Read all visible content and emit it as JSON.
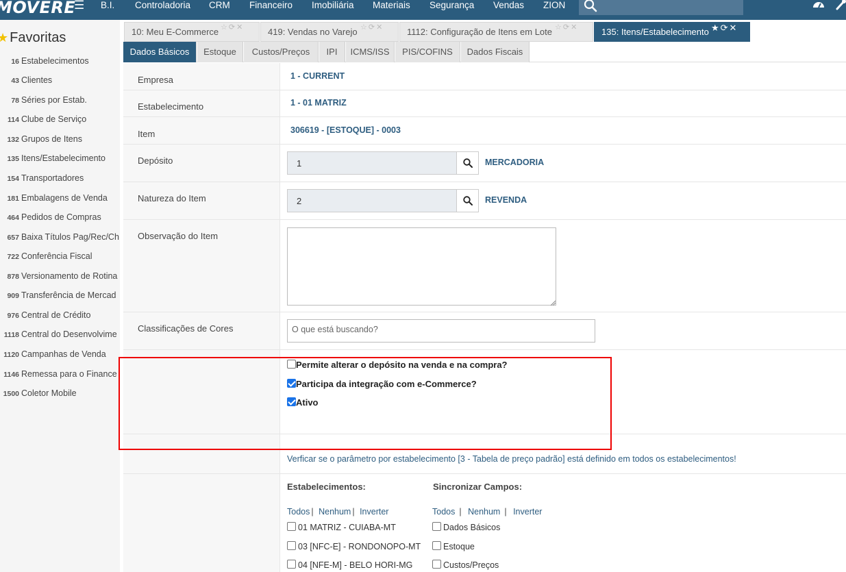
{
  "header": {
    "logo": "MOVERE",
    "nav": [
      "B.I.",
      "Controladoria",
      "CRM",
      "Financeiro",
      "Imobiliária",
      "Materiais",
      "Segurança",
      "Vendas",
      "ZION"
    ],
    "search_icon": "search-icon",
    "right_icons": [
      "dashboard-icon",
      "wrench-icon"
    ]
  },
  "sidebar": {
    "title": "Favoritas",
    "items": [
      {
        "num": "16",
        "label": "Estabelecimentos"
      },
      {
        "num": "43",
        "label": "Clientes"
      },
      {
        "num": "78",
        "label": "Séries por Estab."
      },
      {
        "num": "114",
        "label": "Clube de Serviço"
      },
      {
        "num": "132",
        "label": "Grupos de Itens"
      },
      {
        "num": "135",
        "label": "Itens/Estabelecimento"
      },
      {
        "num": "154",
        "label": "Transportadores"
      },
      {
        "num": "181",
        "label": "Embalagens de Venda"
      },
      {
        "num": "464",
        "label": "Pedidos de Compras"
      },
      {
        "num": "657",
        "label": "Baixa Títulos Pag/Rec/Ch"
      },
      {
        "num": "722",
        "label": "Conferência Fiscal"
      },
      {
        "num": "878",
        "label": "Versionamento de Rotina"
      },
      {
        "num": "909",
        "label": "Transferência de Mercad"
      },
      {
        "num": "976",
        "label": "Central de Crédito"
      },
      {
        "num": "1118",
        "label": "Central do Desenvolvime"
      },
      {
        "num": "1120",
        "label": "Campanhas de Venda"
      },
      {
        "num": "1146",
        "label": "Remessa para o Finance"
      },
      {
        "num": "1500",
        "label": "Coletor Mobile"
      }
    ]
  },
  "tabs": [
    {
      "label": "10: Meu E-Commerce",
      "active": false
    },
    {
      "label": "419: Vendas no Varejo",
      "active": false
    },
    {
      "label": "1112: Configuração de Itens em Lote",
      "active": false
    },
    {
      "label": "135: Itens/Estabelecimento",
      "active": true
    }
  ],
  "subtabs": [
    "Dados Básicos",
    "Estoque",
    "Custos/Preços",
    "IPI",
    "ICMS/ISS",
    "PIS/COFINS",
    "Dados Fiscais"
  ],
  "form": {
    "empresa": {
      "label": "Empresa",
      "value": "1 - CURRENT"
    },
    "estabelecimento": {
      "label": "Estabelecimento",
      "value": "1 - 01 MATRIZ"
    },
    "item": {
      "label": "Item",
      "value": "306619 - [ESTOQUE] - 0003"
    },
    "deposito": {
      "label": "Depósito",
      "value": "1",
      "desc": "MERCADORIA"
    },
    "natureza": {
      "label": "Natureza do Item",
      "value": "2",
      "desc": "REVENDA"
    },
    "observacao": {
      "label": "Observação do Item",
      "value": ""
    },
    "classificacoes": {
      "label": "Classificações de Cores",
      "placeholder": "O que está buscando?"
    },
    "checkboxes": [
      {
        "label": "Permite alterar o depósito na venda e na compra?",
        "checked": false
      },
      {
        "label": "Participa da integração com e-Commerce?",
        "checked": true
      },
      {
        "label": "Ativo",
        "checked": true
      }
    ],
    "notice": "Verficar se o parâmetro por estabelecimento [3 - Tabela de preço padrão] está definido em todos os estabelecimentos!"
  },
  "estabelecimentos": {
    "title": "Estabelecimentos:",
    "links": [
      "Todos",
      "Nenhum",
      "Inverter"
    ],
    "options": [
      {
        "label": "01 MATRIZ - CUIABA-MT",
        "checked": false
      },
      {
        "label": "03 [NFC-E] - RONDONOPO-MT",
        "checked": false
      },
      {
        "label": "04 [NFE-M] - BELO HORI-MG",
        "checked": false
      }
    ]
  },
  "sincronizar": {
    "title": "Sincronizar Campos:",
    "links": [
      "Todos",
      "Nenhum",
      "Inverter"
    ],
    "options": [
      {
        "label": "Dados Básicos",
        "checked": false
      },
      {
        "label": "Estoque",
        "checked": false
      },
      {
        "label": "Custos/Preços",
        "checked": false
      }
    ]
  },
  "colors": {
    "navbar": "#2b5c7e",
    "link": "#2e5d80",
    "highlight_border": "#e00000",
    "checkbox_checked": "#1a73e8"
  }
}
